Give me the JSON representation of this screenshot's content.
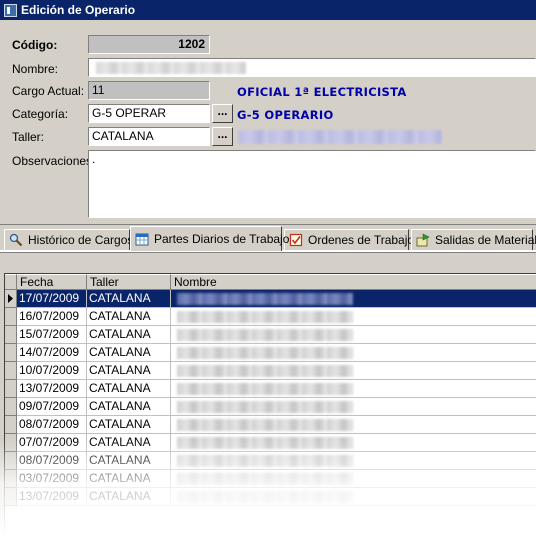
{
  "window": {
    "title": "Edición de Operario",
    "icon": "app-form-icon"
  },
  "form": {
    "codigo_label": "Código:",
    "codigo_value": "1202",
    "nombre_label": "Nombre:",
    "nombre_value": "",
    "cargo_label": "Cargo Actual:",
    "cargo_value": "11",
    "cargo_desc": "OFICIAL 1ª ELECTRICISTA",
    "categoria_label": "Categoría:",
    "categoria_value": "G-5 OPERAR",
    "categoria_desc": "G-5 OPERARIO",
    "taller_label": "Taller:",
    "taller_value": "CATALANA",
    "observaciones_label": "Observaciones:",
    "observaciones_value": ".",
    "lookup_button": "..."
  },
  "tabs": [
    {
      "label": "Histórico de Cargos",
      "icon": "search-icon"
    },
    {
      "label": "Partes Diarios de Trabajo",
      "icon": "calendar-icon",
      "active": true
    },
    {
      "label": "Ordenes de Trabajo",
      "icon": "checklist-icon"
    },
    {
      "label": "Salidas de Material",
      "icon": "export-icon"
    }
  ],
  "grid": {
    "columns": [
      "Fecha",
      "Taller",
      "Nombre"
    ],
    "rows": [
      {
        "fecha": "17/07/2009",
        "taller": "CATALANA",
        "selected": true
      },
      {
        "fecha": "16/07/2009",
        "taller": "CATALANA"
      },
      {
        "fecha": "15/07/2009",
        "taller": "CATALANA"
      },
      {
        "fecha": "14/07/2009",
        "taller": "CATALANA"
      },
      {
        "fecha": "10/07/2009",
        "taller": "CATALANA"
      },
      {
        "fecha": "13/07/2009",
        "taller": "CATALANA"
      },
      {
        "fecha": "09/07/2009",
        "taller": "CATALANA"
      },
      {
        "fecha": "08/07/2009",
        "taller": "CATALANA"
      },
      {
        "fecha": "07/07/2009",
        "taller": "CATALANA"
      },
      {
        "fecha": "08/07/2009",
        "taller": "CATALANA"
      },
      {
        "fecha": "03/07/2009",
        "taller": "CATALANA"
      },
      {
        "fecha": "13/07/2009",
        "taller": "CATALANA"
      }
    ]
  },
  "colors": {
    "title_bar": "#0a246a",
    "panel": "#d4d0c8",
    "accent_text": "#0000a8",
    "selection": "#0a246a"
  }
}
